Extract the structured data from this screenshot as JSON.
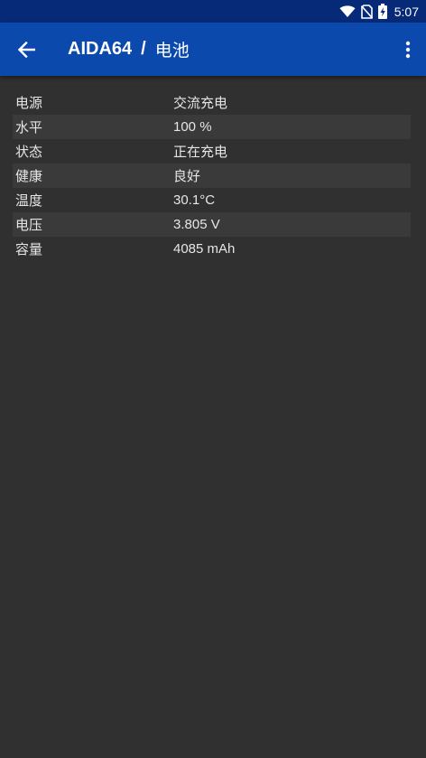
{
  "status_bar": {
    "time": "5:07",
    "icons": [
      "wifi-icon",
      "no-sim-icon",
      "battery-charging-icon"
    ]
  },
  "app_bar": {
    "brand": "AIDA64",
    "separator": "/",
    "title": "电池",
    "back_icon": "arrow-back-icon",
    "menu_icon": "more-vert-icon"
  },
  "colors": {
    "status_bar": "#062a78",
    "app_bar": "#0b49ac",
    "background": "#303030",
    "row_alt": "#3a3a3a",
    "text": "#e6e6e6"
  },
  "battery": {
    "rows": [
      {
        "label": "电源",
        "value": "交流充电"
      },
      {
        "label": "水平",
        "value": "100 %"
      },
      {
        "label": "状态",
        "value": "正在充电"
      },
      {
        "label": "健康",
        "value": "良好"
      },
      {
        "label": "温度",
        "value": "30.1°C"
      },
      {
        "label": "电压",
        "value": "3.805 V"
      },
      {
        "label": "容量",
        "value": "4085 mAh"
      }
    ]
  }
}
